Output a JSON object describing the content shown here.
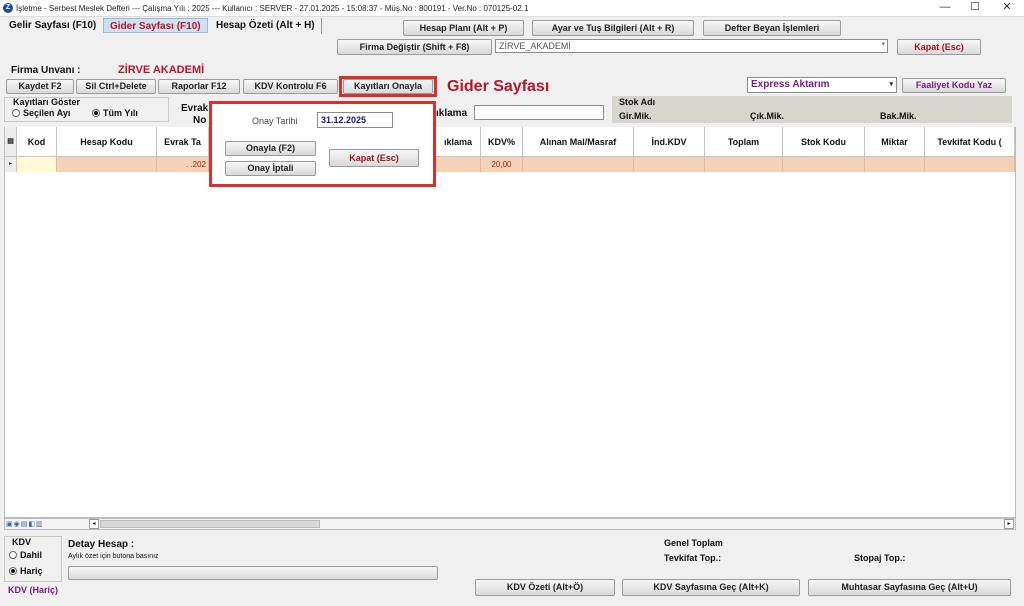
{
  "window": {
    "title": "İşletme - Serbest Meslek Defteri  ---  Çalışma Yılı : 2025  ---  Kullanıcı : SERVER - 27.01.2025 - 15:08:37 - Müş.No : 800191 - Ver.No : 070125-02.1",
    "minimize": "—",
    "maximize": "☐",
    "close": "✕"
  },
  "tabs": [
    {
      "label": "Gelir Sayfası (F10)"
    },
    {
      "label": "Gider Sayfası (F10)"
    },
    {
      "label": "Hesap Özeti (Alt + H)"
    }
  ],
  "top_buttons": {
    "hesap_plani": "Hesap Planı (Alt + P)",
    "ayar": "Ayar ve Tuş Bilgileri (Alt + R)",
    "defter_beyan": "Defter Beyan İşlemleri",
    "firma_degistir": "Firma Değiştir (Shift + F8)",
    "kapat": "Kapat (Esc)"
  },
  "firma_select": "ZİRVE_AKADEMİ",
  "firma": {
    "label": "Firma Unvanı :",
    "value": "ZİRVE AKADEMİ"
  },
  "toolbar": {
    "kaydet": "Kaydet F2",
    "sil": "Sil Ctrl+Delete",
    "raporlar": "Raporlar F12",
    "kdv_kontrolu": "KDV Kontrolu F6",
    "kayitlari_onayla": "Kayıtları Onayla"
  },
  "page_title": "Gider Sayfası",
  "express_select": "Express Aktarım",
  "faaliyet_button": "Faaliyet Kodu Yaz",
  "kayitlari_goster": {
    "label": "Kayıtları Göster",
    "secilen_ayi": "Seçilen Ayı",
    "tum_yili": "Tüm Yılı",
    "selected": "tum_yili"
  },
  "evrak_no": {
    "line1": "Evrak",
    "line2": "No"
  },
  "aciklama_label": "ıklama",
  "stok": {
    "stok_adi": "Stok Adı",
    "gir_mik": "Gir.Mik.",
    "cik_mik": "Çık.Mik.",
    "bak_mik": "Bak.Mik."
  },
  "grid": {
    "headers": [
      "Kod",
      "Hesap Kodu",
      "Evrak Ta",
      "ıklama",
      "KDV%",
      "Alınan Mal/Masraf",
      "İnd.KDV",
      "Toplam",
      "Stok Kodu",
      "Miktar",
      "Tevkifat Kodu ("
    ],
    "row": {
      "evrak_tarihi": ". .202",
      "kdv": "20,00"
    }
  },
  "dialog": {
    "onay_tarihi_label": "Onay Tarihi",
    "onay_tarihi_value": "31.12.2025",
    "onayla": "Onayla (F2)",
    "onay_iptali": "Onay İptali",
    "kapat": "Kapat (Esc)"
  },
  "bottom": {
    "kdv_group": "KDV",
    "dahil": "Dahil",
    "haric": "Hariç",
    "kdv_status": "KDV (Hariç)",
    "detay_hesap": "Detay Hesap :",
    "aylik_ozet": "Aylık özet için butona basınız",
    "genel_toplam": "Genel Toplam",
    "tevkifat_top": "Tevkifat  Top.:",
    "stopaj_top": "Stopaj  Top.:",
    "kdv_ozeti": "KDV Özeti (Alt+Ö)",
    "kdv_sayfasina": "KDV Sayfasına Geç (Alt+K)",
    "muhtasar": "Muhtasar Sayfasına Geç (Alt+U)"
  },
  "colors": {
    "accent_red": "#b8152a",
    "highlight_red": "#d8302c",
    "row_fill": "#f5d2b6",
    "purple": "#7a1a8a"
  }
}
